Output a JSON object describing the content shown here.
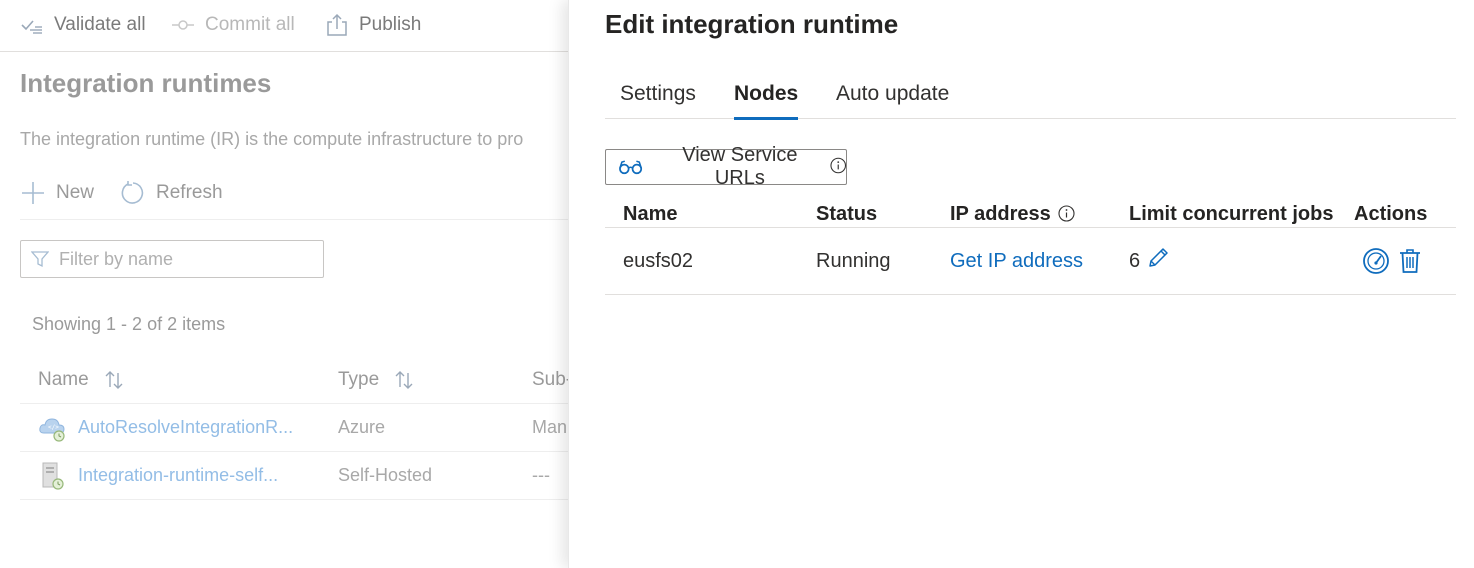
{
  "toolbar": {
    "validate_label": "Validate all",
    "commit_label": "Commit all",
    "publish_label": "Publish"
  },
  "background": {
    "title": "Integration runtimes",
    "description": "The integration runtime (IR) is the compute infrastructure to pro",
    "new_label": "New",
    "refresh_label": "Refresh",
    "filter_placeholder": "Filter by name",
    "showing": "Showing 1 - 2 of 2 items",
    "columns": {
      "name": "Name",
      "type": "Type",
      "sub": "Sub-"
    },
    "rows": [
      {
        "name": "AutoResolveIntegrationR...",
        "type": "Azure",
        "sub": "Man",
        "icon": "azure-cloud-icon"
      },
      {
        "name": "Integration-runtime-self...",
        "type": "Self-Hosted",
        "sub": "---",
        "icon": "self-hosted-server-icon"
      }
    ]
  },
  "panel": {
    "title": "Edit integration runtime",
    "tabs": [
      {
        "label": "Settings",
        "active": false
      },
      {
        "label": "Nodes",
        "active": true
      },
      {
        "label": "Auto update",
        "active": false
      }
    ],
    "view_service_urls_label": "View Service URLs",
    "columns": {
      "name": "Name",
      "status": "Status",
      "ip": "IP address",
      "limit": "Limit concurrent jobs",
      "actions": "Actions"
    },
    "nodes": [
      {
        "name": "eusfs02",
        "status": "Running",
        "ip_link": "Get IP address",
        "limit": "6"
      }
    ]
  },
  "colors": {
    "accent": "#0f6cbd",
    "dim_link": "#93bde6"
  }
}
